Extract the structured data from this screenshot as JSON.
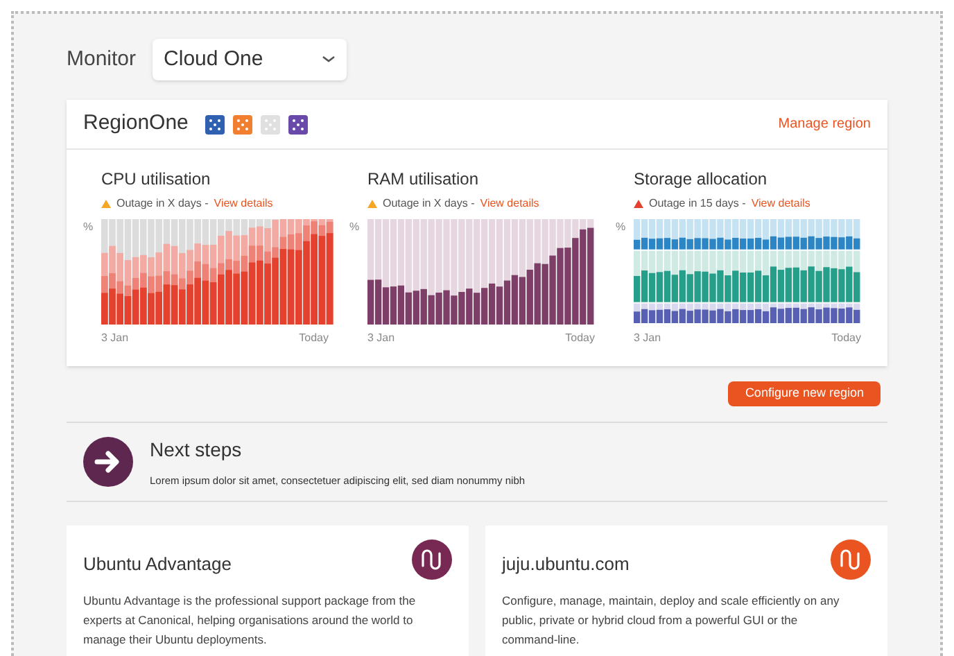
{
  "monitor": {
    "label": "Monitor",
    "select": {
      "value": "Cloud One"
    }
  },
  "region": {
    "title": "RegionOne",
    "services": [
      {
        "color": "#3060b0"
      },
      {
        "color": "#f08030"
      },
      {
        "color": "#e0e0e0"
      },
      {
        "color": "#6a4aa8"
      }
    ],
    "manage_link": "Manage region",
    "charts": [
      {
        "kind": "cpu",
        "title": "CPU utilisation",
        "alert": {
          "color": "#f5a623"
        },
        "outage": "Outage in X days -",
        "link": "View details",
        "unit": "%",
        "start": "3 Jan",
        "end": "Today"
      },
      {
        "kind": "ram",
        "title": "RAM utilisation",
        "alert": {
          "color": "#f5a623"
        },
        "outage": "Outage in X days -",
        "link": "View details",
        "unit": "%",
        "start": "3 Jan",
        "end": "Today"
      },
      {
        "kind": "storage",
        "title": "Storage allocation",
        "alert": {
          "color": "#e5412f"
        },
        "outage": "Outage in 15 days -",
        "link": "View details",
        "unit": "%",
        "start": "3 Jan",
        "end": "Today"
      }
    ]
  },
  "configure_button": "Configure new region",
  "next_steps": {
    "title": "Next steps",
    "text": "Lorem ipsum dolor sit amet, consectetuer adipiscing elit, sed diam nonummy nibh"
  },
  "cards": [
    {
      "title": "Ubuntu Advantage",
      "text": "Ubuntu Advantage is the professional support package from the experts at Canonical, helping organisations around the world to manage their Ubuntu deployments.",
      "color": "#772953"
    },
    {
      "title": "juju.ubuntu.com",
      "text": "Configure, manage, maintain, deploy and scale efficiently on any public, private or hybrid cloud from a powerful GUI or the command-line.",
      "color": "#e95420"
    }
  ]
}
